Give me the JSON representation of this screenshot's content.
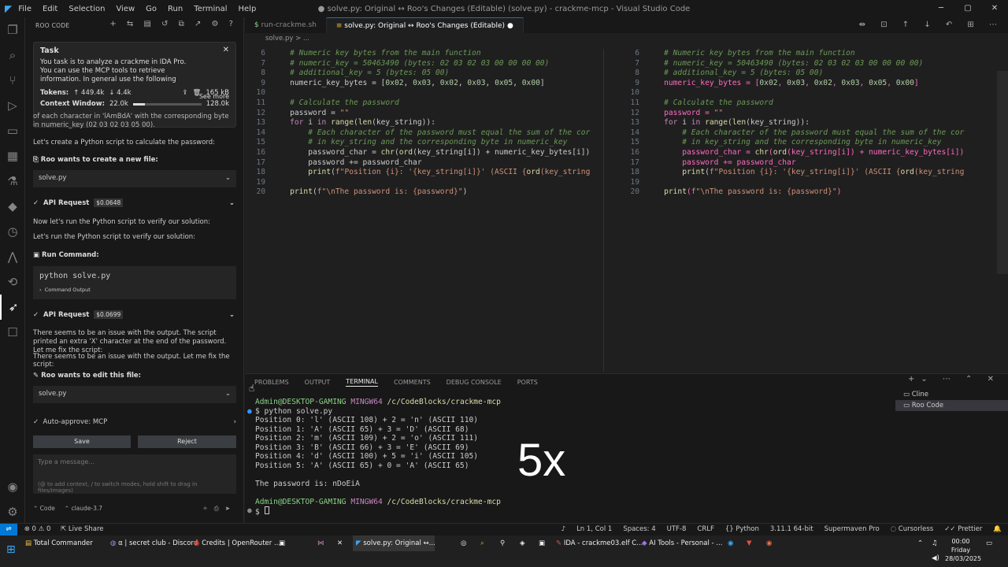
{
  "titlebar": {
    "menus": [
      "File",
      "Edit",
      "Selection",
      "View",
      "Go",
      "Run",
      "Terminal",
      "Help"
    ],
    "title": "● solve.py: Original ↔ Roo's Changes (Editable) (solve.py) - crackme-mcp - Visual Studio Code"
  },
  "sidebar": {
    "header": "ROO CODE",
    "task": {
      "title": "Task",
      "text": "You task is to analyze a crackme in IDA Pro. You can use the MCP tools to retrieve information. In general use the following strategy:...",
      "see_more": "See more",
      "tokens_label": "Tokens:",
      "tokens_up": "↑ 449.4k",
      "tokens_down": "↓ 4.4k",
      "size": "165 kB",
      "ctx_label": "Context Window:",
      "ctx_used": "22.0k",
      "ctx_max": "128.0k",
      "ctx_fraction": 0.17
    },
    "frag": "of each character in 'lAmBdA' with the corresponding byte in numeric_key (02 03 02 03 05 00).",
    "msg1": "Let's create a Python script to calculate the password:",
    "create_file": "Roo wants to create a new file:",
    "file1": "solve.py",
    "api1": {
      "label": "API Request",
      "cost": "$0.0648"
    },
    "msg2": "Now let's run the Python script to verify our solution:",
    "msg3": "Let's run the Python script to verify our solution:",
    "run_cmd": "Run Command:",
    "cmd": "python solve.py",
    "cmd_output": "Command Output",
    "api2": {
      "label": "API Request",
      "cost": "$0.0699"
    },
    "msg4": "There seems to be an issue with the output. The script printed an extra 'X' character at the end of the password. Let me fix the script:",
    "msg5": "There seems to be an issue with the output. Let me fix the script:",
    "edit_file": "Roo wants to edit this file:",
    "file2": "solve.py",
    "auto_approve": "Auto-approve: MCP",
    "save": "Save",
    "reject": "Reject",
    "input_placeholder": "Type a message...",
    "input_hint": "(@ to add context, / to switch modes, hold shift to drag in files/images)",
    "mode": "Code",
    "model": "claude-3.7"
  },
  "editor": {
    "tabs": [
      "run-crackme.sh",
      "solve.py: Original ↔ Roo's Changes (Editable)"
    ],
    "breadcrumb": "solve.py > ..."
  },
  "code_lines": [
    {
      "n": "6",
      "t": "    # Numeric key bytes from the main function"
    },
    {
      "n": "7",
      "t": "    # numeric_key = 50463490 (bytes: 02 03 02 03 00 00 00 00)"
    },
    {
      "n": "8",
      "t": "    # additional_key = 5 (bytes: 05 00)"
    },
    {
      "n": "9",
      "t": "    numeric_key_bytes = [0x02, 0x03, 0x02, 0x03, 0x05, 0x00]"
    },
    {
      "n": "10",
      "t": ""
    },
    {
      "n": "11",
      "t": "    # Calculate the password"
    },
    {
      "n": "12",
      "t": "    password = \"\""
    },
    {
      "n": "13",
      "t": "    for i in range(len(key_string)):"
    },
    {
      "n": "14",
      "t": "        # Each character of the password must equal the sum of the cor"
    },
    {
      "n": "15",
      "t": "        # in key_string and the corresponding byte in numeric_key"
    },
    {
      "n": "16",
      "t": "        password_char = chr(ord(key_string[i]) + numeric_key_bytes[i])"
    },
    {
      "n": "17",
      "t": "        password += password_char"
    },
    {
      "n": "18",
      "t": "        print(f\"Position {i}: '{key_string[i]}' (ASCII {ord(key_string"
    },
    {
      "n": "19",
      "t": ""
    },
    {
      "n": "20",
      "t": "    print(f\"\\nThe password is: {password}\")"
    }
  ],
  "panel": {
    "tabs": [
      "PROBLEMS",
      "OUTPUT",
      "TERMINAL",
      "COMMENTS",
      "DEBUG CONSOLE",
      "PORTS"
    ],
    "terminals": [
      "Cline",
      "Roo Code"
    ],
    "prompt_user": "Admin@DESKTOP-GAMING",
    "prompt_env": "MINGW64",
    "prompt_path": "/c/CodeBlocks/crackme-mcp",
    "cmd": "$ python solve.py",
    "output": [
      "Position 0: 'l' (ASCII 108) + 2 = 'n' (ASCII 110)",
      "Position 1: 'A' (ASCII 65) + 3 = 'D' (ASCII 68)",
      "Position 2: 'm' (ASCII 109) + 2 = 'o' (ASCII 111)",
      "Position 3: 'B' (ASCII 66) + 3 = 'E' (ASCII 69)",
      "Position 4: 'd' (ASCII 100) + 5 = 'i' (ASCII 105)",
      "Position 5: 'A' (ASCII 65) + 0 = 'A' (ASCII 65)"
    ],
    "result": "The password is: nDoEiA",
    "prompt2": "$ ",
    "overlay": "5x"
  },
  "status": {
    "errors": "⊗ 0 ⚠ 0",
    "live_share": "Live Share",
    "pos": "Ln 1, Col 1",
    "spaces": "Spaces: 4",
    "enc": "UTF-8",
    "eol": "CRLF",
    "lang": "Python",
    "interp": "3.11.1 64-bit",
    "maven": "Supermaven Pro",
    "cursorless": "Cursorless",
    "prettier": "Prettier"
  },
  "taskbar": {
    "apps": [
      "Total Commander",
      "α | secret club - Discord",
      "Credits | OpenRouter ...",
      "solve.py: Original ↔...",
      "IDA - crackme03.elf C...",
      "AI Tools - Personal - ..."
    ],
    "time": "00:00",
    "day": "Friday",
    "date": "28/03/2025"
  }
}
